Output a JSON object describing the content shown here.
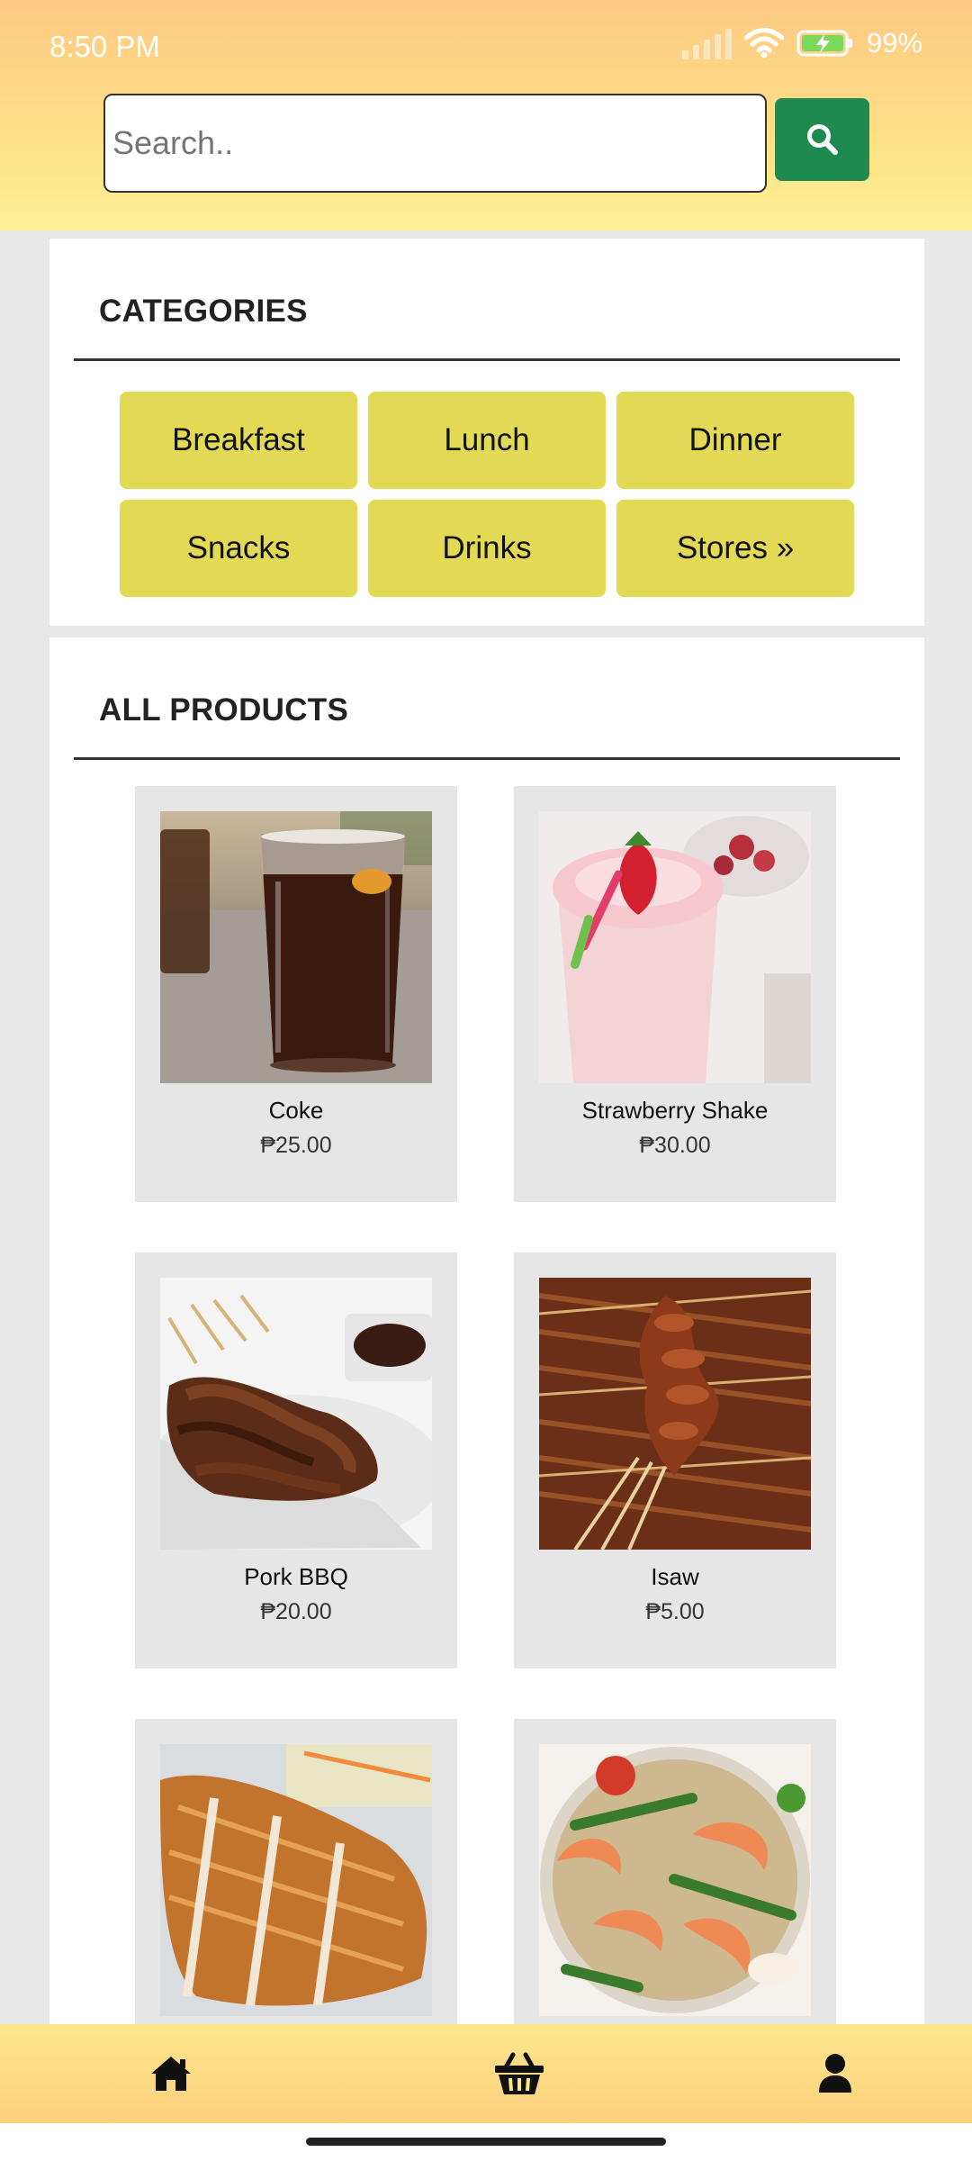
{
  "status_bar": {
    "time": "8:50 PM",
    "battery": "99%"
  },
  "search": {
    "placeholder": "Search.."
  },
  "categories": {
    "title": "CATEGORIES",
    "items": [
      {
        "label": "Breakfast"
      },
      {
        "label": "Lunch"
      },
      {
        "label": "Dinner"
      },
      {
        "label": "Snacks"
      },
      {
        "label": "Drinks"
      },
      {
        "label": "Stores »"
      }
    ]
  },
  "products": {
    "title": "ALL PRODUCTS",
    "items": [
      {
        "name": "Coke",
        "price": "₱25.00",
        "image": "coke-photo"
      },
      {
        "name": "Strawberry Shake",
        "price": "₱30.00",
        "image": "strawberry-shake-photo"
      },
      {
        "name": "Pork BBQ",
        "price": "₱20.00",
        "image": "pork-bbq-photo"
      },
      {
        "name": "Isaw",
        "price": "₱5.00",
        "image": "isaw-photo"
      },
      {
        "name": "",
        "price": "",
        "image": "fried-cutlet-photo"
      },
      {
        "name": "",
        "price": "",
        "image": "shrimp-sinigang-photo"
      }
    ]
  },
  "bottom_nav": {
    "items": [
      {
        "icon": "home-icon"
      },
      {
        "icon": "basket-icon"
      },
      {
        "icon": "user-icon"
      }
    ]
  },
  "colors": {
    "header_top": "#fdc983",
    "header_bottom": "#fff19a",
    "search_button": "#1f8a4f",
    "category_button": "#e2da55",
    "card_background": "#e6e6e6"
  }
}
